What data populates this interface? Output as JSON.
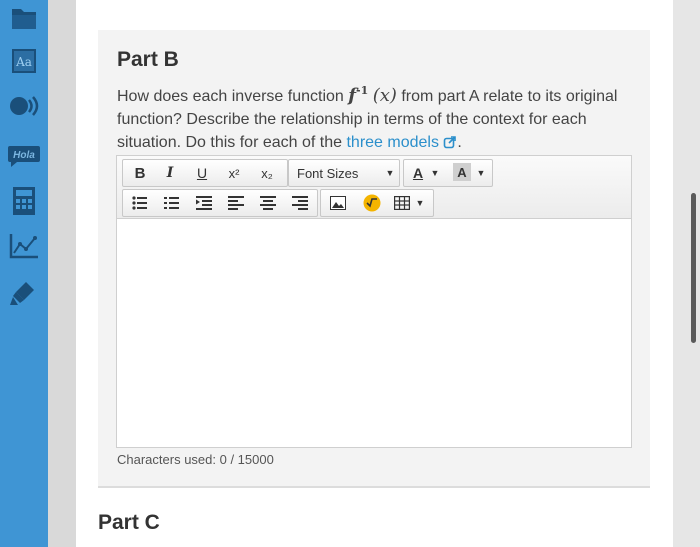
{
  "rail": {
    "items": [
      {
        "icon": "folder-icon"
      },
      {
        "icon": "dictionary-icon",
        "label": "Aa"
      },
      {
        "icon": "audio-icon"
      },
      {
        "icon": "translate-icon",
        "label": "Hola"
      },
      {
        "icon": "calculator-icon"
      },
      {
        "icon": "graph-icon"
      },
      {
        "icon": "highlighter-icon"
      }
    ]
  },
  "part_b": {
    "title": "Part B",
    "prompt_before": "How does each inverse function ",
    "fn_name": "f",
    "fn_exp": "-1",
    "fn_arg": "(x)",
    "prompt_after": " from part A relate to its original function? Describe the relationship in terms of the context for each situation. Do this for each of the ",
    "link_text": "three models",
    "prompt_end": "."
  },
  "editor": {
    "toolbar": {
      "bold": "B",
      "italic": "I",
      "underline": "U",
      "superscript": "x²",
      "subscript": "x₂",
      "font_sizes": "Font Sizes",
      "text_color": "A",
      "bg_color": "A"
    },
    "value": ""
  },
  "char_count": "Characters used: 0 / 15000",
  "part_c": {
    "title": "Part C"
  },
  "colors": {
    "rail": "#3f95d4",
    "link": "#2b8fcb",
    "accent_yellow": "#f4b400"
  }
}
